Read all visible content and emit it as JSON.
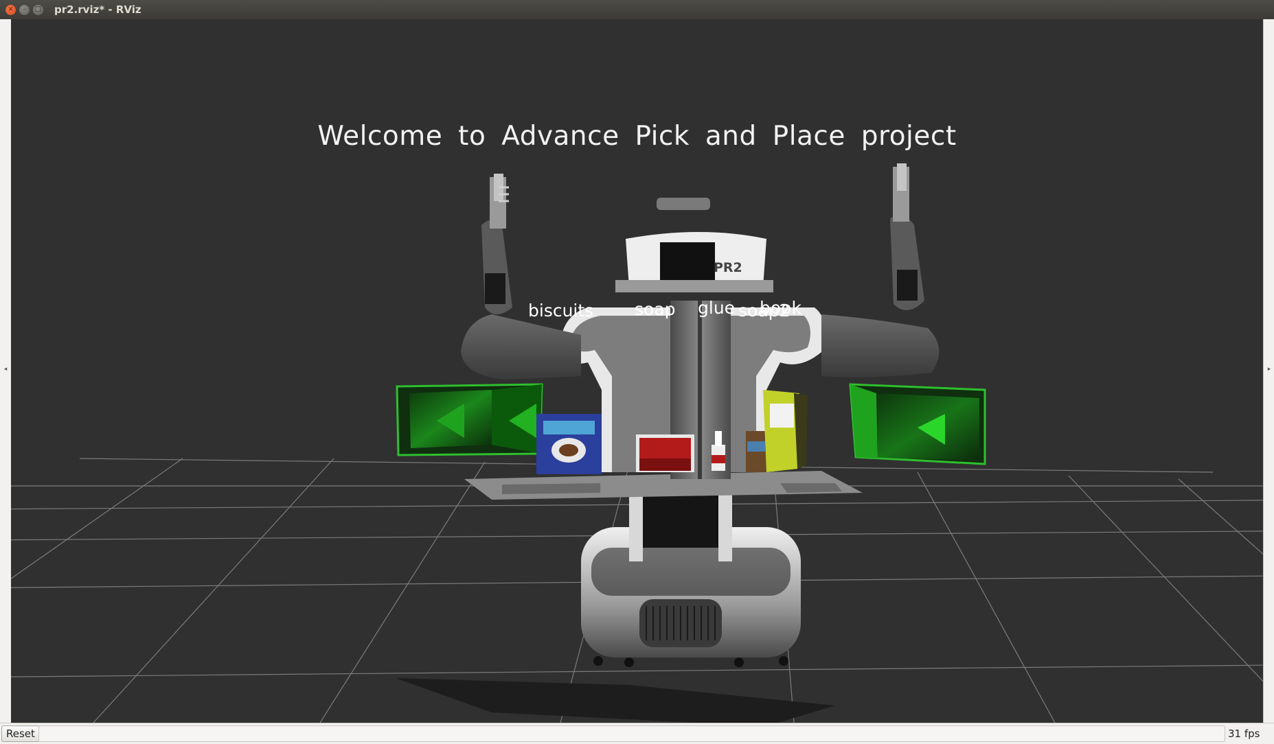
{
  "window": {
    "title": "pr2.rviz* - RViz",
    "close_glyph": "×",
    "minimize_glyph": "–",
    "maximize_glyph": "□"
  },
  "panels": {
    "left_arrow": "◂",
    "right_arrow": "▸"
  },
  "scene": {
    "welcome_text": "Welcome to Advance Pick and Place project",
    "robot_badge": "PR2",
    "object_labels": {
      "biscuits": "biscuits",
      "soap": "soap",
      "glue": "glue",
      "soap2": "soap2",
      "book": "book"
    }
  },
  "statusbar": {
    "reset_label": "Reset",
    "fps": "31 fps"
  },
  "colors": {
    "viewport_bg": "#303030",
    "grid": "#8a8a8a",
    "dropbox_green": "#1fa31f",
    "titlebar": "#3c3b37"
  },
  "icons": {
    "close": "close-icon",
    "minimize": "minimize-icon",
    "maximize": "maximize-icon"
  }
}
